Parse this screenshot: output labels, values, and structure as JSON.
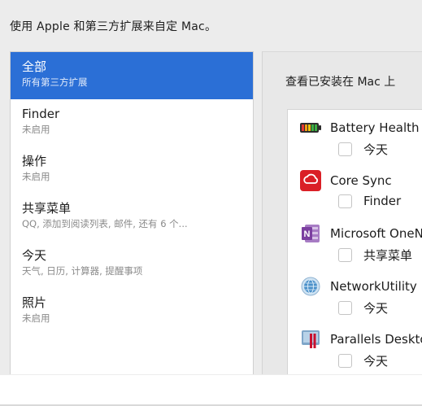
{
  "header": {
    "text": "使用 Apple 和第三方扩展来自定 Mac。"
  },
  "categories": [
    {
      "title": "全部",
      "subtitle": "所有第三方扩展",
      "selected": true
    },
    {
      "title": "Finder",
      "subtitle": "未启用"
    },
    {
      "title": "操作",
      "subtitle": "未启用"
    },
    {
      "title": "共享菜单",
      "subtitle": "QQ, 添加到阅读列表, 邮件, 还有 6 个..."
    },
    {
      "title": "今天",
      "subtitle": "天气, 日历, 计算器, 提醒事项"
    },
    {
      "title": "照片",
      "subtitle": "未启用"
    }
  ],
  "right": {
    "title": "查看已安装在 Mac 上",
    "extensions": [
      {
        "name": "Battery Health",
        "location": "今天",
        "icon": "battery-icon"
      },
      {
        "name": "Core Sync",
        "location": "Finder",
        "icon": "creative-cloud-icon"
      },
      {
        "name": "Microsoft OneNote",
        "location": "共享菜单",
        "icon": "onenote-icon"
      },
      {
        "name": "NetworkUtility",
        "location": "今天",
        "icon": "network-globe-icon"
      },
      {
        "name": "Parallels Desktop",
        "location": "今天",
        "icon": "parallels-icon"
      }
    ]
  },
  "colors": {
    "selection": "#2b6fd6",
    "battery_green": "#3cb043",
    "battery_red": "#e53935",
    "creative_cloud_red": "#da1f26",
    "onenote_purple": "#7b3fa0",
    "network_blue": "#4a90c9",
    "parallels_red": "#c8102e"
  }
}
